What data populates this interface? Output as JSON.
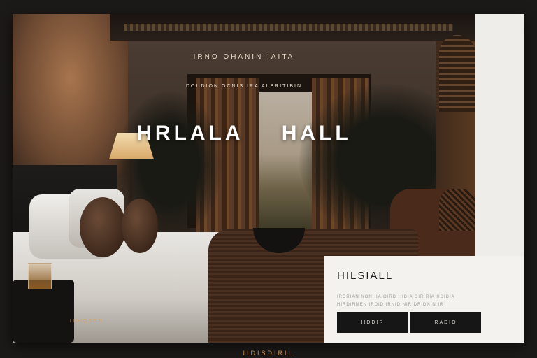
{
  "hero": {
    "tagline": "IRNO OHANIN IAITA",
    "subtagline": "DOUDION OCNIS IRA ALBRITIBIN",
    "title": "HRLALA HALL",
    "footnote": "IIDIOSOR"
  },
  "card": {
    "title": "HILSIALL",
    "description": "IRDRIAN NON IIA OIRD HIDIA DIR RIA IIDIDIA HIRDIRMEN IRDID IRNID NIR DRIDNIN IR",
    "primary_button": "IIDDIR",
    "secondary_button": "RADIO"
  },
  "footer": {
    "text": "IIDISDIRIL"
  },
  "colors": {
    "page_background": "#1c1a18",
    "card_background": "#f3f2ef",
    "button_background": "#161616",
    "accent": "#c88a4a"
  }
}
